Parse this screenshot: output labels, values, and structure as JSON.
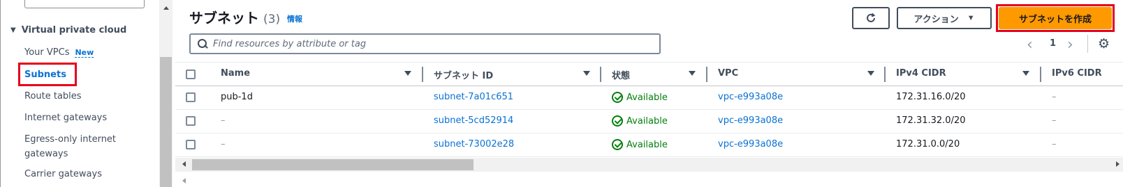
{
  "sidebar": {
    "section_title": "Virtual private cloud",
    "items": [
      {
        "label": "Your VPCs",
        "badge": "New"
      },
      {
        "label": "Subnets",
        "active": true
      },
      {
        "label": "Route tables"
      },
      {
        "label": "Internet gateways"
      },
      {
        "label": "Egress-only internet",
        "label_line2": "gateways"
      },
      {
        "label": "Carrier gateways"
      }
    ]
  },
  "header": {
    "title": "サブネット",
    "count": "(3)",
    "info_link": "情報"
  },
  "toolbar": {
    "refresh_icon": "refresh-icon",
    "actions_label": "アクション",
    "create_label": "サブネットを作成"
  },
  "search": {
    "placeholder": "Find resources by attribute or tag",
    "value": ""
  },
  "pagination": {
    "current_page": "1"
  },
  "table": {
    "columns": [
      "Name",
      "サブネット ID",
      "状態",
      "VPC",
      "IPv4 CIDR",
      "IPv6 CIDR"
    ],
    "rows": [
      {
        "name": "pub-1d",
        "subnet_id": "subnet-7a01c651",
        "state": "Available",
        "vpc": "vpc-e993a08e",
        "ipv4": "172.31.16.0/20",
        "ipv6": "–"
      },
      {
        "name": "–",
        "subnet_id": "subnet-5cd52914",
        "state": "Available",
        "vpc": "vpc-e993a08e",
        "ipv4": "172.31.32.0/20",
        "ipv6": "–"
      },
      {
        "name": "–",
        "subnet_id": "subnet-73002e28",
        "state": "Available",
        "vpc": "vpc-e993a08e",
        "ipv4": "172.31.0.0/20",
        "ipv6": "–"
      }
    ]
  },
  "colors": {
    "accent": "#0972d3",
    "primary_button": "#ff9900",
    "success": "#037f0c",
    "highlight": "#e5001b"
  }
}
